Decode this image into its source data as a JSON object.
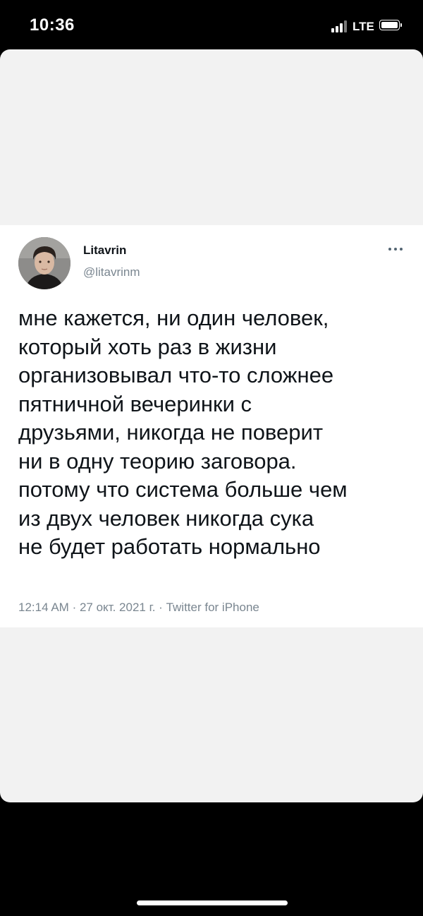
{
  "status_bar": {
    "time": "10:36",
    "network": "LTE"
  },
  "tweet": {
    "author_name": "Litavrin",
    "author_handle": "@litavrinm",
    "more_label": "...",
    "text_lines": [
      "мне кажется, ни один человек,",
      "который хоть раз в жизни",
      "организовывал что-то сложнее",
      "пятничной вечеринки с",
      "друзьями, никогда не поверит",
      "ни в одну теорию заговора.",
      "потому что система больше чем",
      "из двух человек никогда сука",
      "не будет работать нормально"
    ],
    "time": "12:14 AM",
    "date": "27 окт. 2021 г.",
    "separator": "·",
    "source": "Twitter for iPhone"
  },
  "icons": {
    "signal": "cellular-signal-icon",
    "battery": "battery-icon",
    "more": "more-horizontal-icon"
  }
}
